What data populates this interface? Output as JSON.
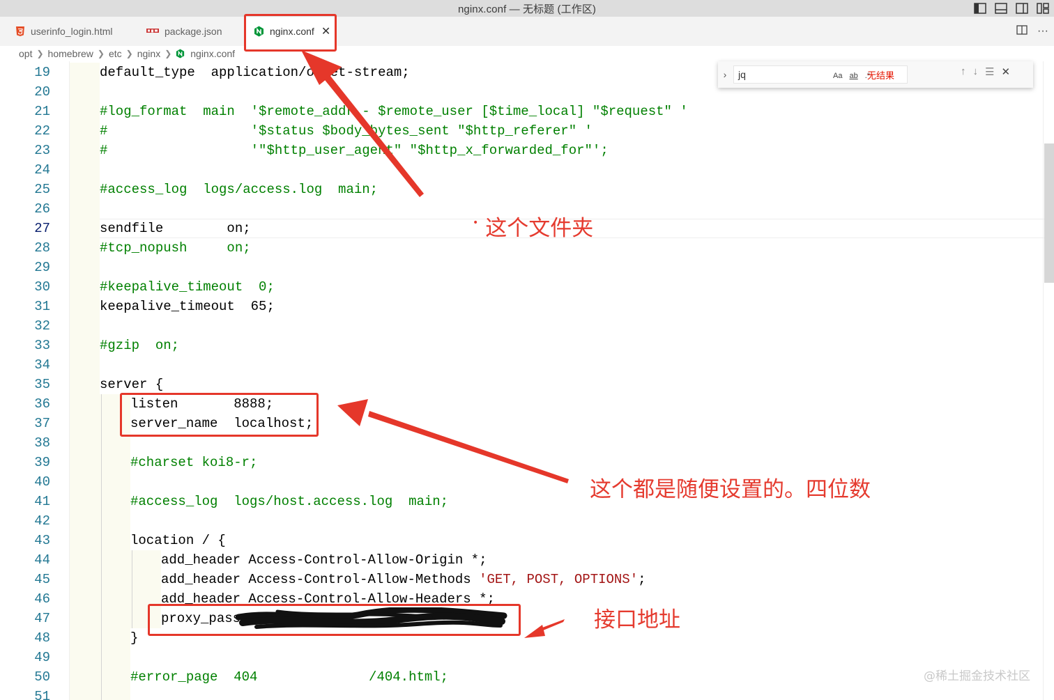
{
  "window": {
    "title": "nginx.conf — 无标题 (工作区)"
  },
  "tabs": [
    {
      "label": "userinfo_login.html",
      "icon": "html5-icon"
    },
    {
      "label": "package.json",
      "icon": "npm-icon"
    },
    {
      "label": "nginx.conf",
      "icon": "nginx-icon",
      "active": true
    }
  ],
  "breadcrumb": [
    "opt",
    "homebrew",
    "etc",
    "nginx",
    "nginx.conf"
  ],
  "find": {
    "value": "jq",
    "opt_case": "Aa",
    "opt_word": "ab",
    "opt_regex": ".*",
    "status": "无结果"
  },
  "code": {
    "lines": [
      {
        "n": "19",
        "text": "default_type  application/octet-stream;",
        "indent": 0,
        "kind": "code"
      },
      {
        "n": "20",
        "text": "",
        "indent": 0,
        "kind": "code"
      },
      {
        "n": "21",
        "text": "#log_format  main  '$remote_addr - $remote_user [$time_local] \"$request\" '",
        "indent": 0,
        "kind": "comment"
      },
      {
        "n": "22",
        "text": "#                  '$status $body_bytes_sent \"$http_referer\" '",
        "indent": 0,
        "kind": "comment"
      },
      {
        "n": "23",
        "text": "#                  '\"$http_user_agent\" \"$http_x_forwarded_for\"';",
        "indent": 0,
        "kind": "comment"
      },
      {
        "n": "24",
        "text": "",
        "indent": 0,
        "kind": "code"
      },
      {
        "n": "25",
        "text": "#access_log  logs/access.log  main;",
        "indent": 0,
        "kind": "comment"
      },
      {
        "n": "26",
        "text": "",
        "indent": 0,
        "kind": "code"
      },
      {
        "n": "27",
        "text": "sendfile        on;",
        "indent": 0,
        "kind": "code",
        "current": true
      },
      {
        "n": "28",
        "text": "#tcp_nopush     on;",
        "indent": 0,
        "kind": "comment"
      },
      {
        "n": "29",
        "text": "",
        "indent": 0,
        "kind": "code"
      },
      {
        "n": "30",
        "text": "#keepalive_timeout  0;",
        "indent": 0,
        "kind": "comment"
      },
      {
        "n": "31",
        "text": "keepalive_timeout  65;",
        "indent": 0,
        "kind": "code"
      },
      {
        "n": "32",
        "text": "",
        "indent": 0,
        "kind": "code"
      },
      {
        "n": "33",
        "text": "#gzip  on;",
        "indent": 0,
        "kind": "comment"
      },
      {
        "n": "34",
        "text": "",
        "indent": 0,
        "kind": "code"
      },
      {
        "n": "35",
        "text": "server {",
        "indent": 0,
        "kind": "code"
      },
      {
        "n": "36",
        "text": "listen       8888;",
        "indent": 1,
        "kind": "code"
      },
      {
        "n": "37",
        "text": "server_name  localhost;",
        "indent": 1,
        "kind": "code"
      },
      {
        "n": "38",
        "text": "",
        "indent": 1,
        "kind": "code"
      },
      {
        "n": "39",
        "text": "#charset koi8-r;",
        "indent": 1,
        "kind": "comment"
      },
      {
        "n": "40",
        "text": "",
        "indent": 1,
        "kind": "code"
      },
      {
        "n": "41",
        "text": "#access_log  logs/host.access.log  main;",
        "indent": 1,
        "kind": "comment"
      },
      {
        "n": "42",
        "text": "",
        "indent": 1,
        "kind": "code"
      },
      {
        "n": "43",
        "text": "location / {",
        "indent": 1,
        "kind": "code"
      },
      {
        "n": "44",
        "text": "add_header Access-Control-Allow-Origin *;",
        "indent": 2,
        "kind": "code"
      },
      {
        "n": "45",
        "text": "add_header Access-Control-Allow-Methods ",
        "indent": 2,
        "kind": "code",
        "str": "'GET, POST, OPTIONS'",
        "tail": ";"
      },
      {
        "n": "46",
        "text": "add_header Access-Control-Allow-Headers *;",
        "indent": 2,
        "kind": "code"
      },
      {
        "n": "47",
        "text": "proxy_pass ",
        "indent": 2,
        "kind": "code"
      },
      {
        "n": "48",
        "text": "}",
        "indent": 1,
        "kind": "code"
      },
      {
        "n": "49",
        "text": "",
        "indent": 1,
        "kind": "code"
      },
      {
        "n": "50",
        "text": "#error_page  404              /404.html;",
        "indent": 1,
        "kind": "comment"
      },
      {
        "n": "51",
        "text": "",
        "indent": 1,
        "kind": "code"
      }
    ]
  },
  "annotations": {
    "folder_note": "这个文件夹",
    "port_note": "这个都是随便设置的。四位数",
    "api_note": "接口地址",
    "color": "#e5372a"
  },
  "watermark": "@稀土掘金技术社区"
}
